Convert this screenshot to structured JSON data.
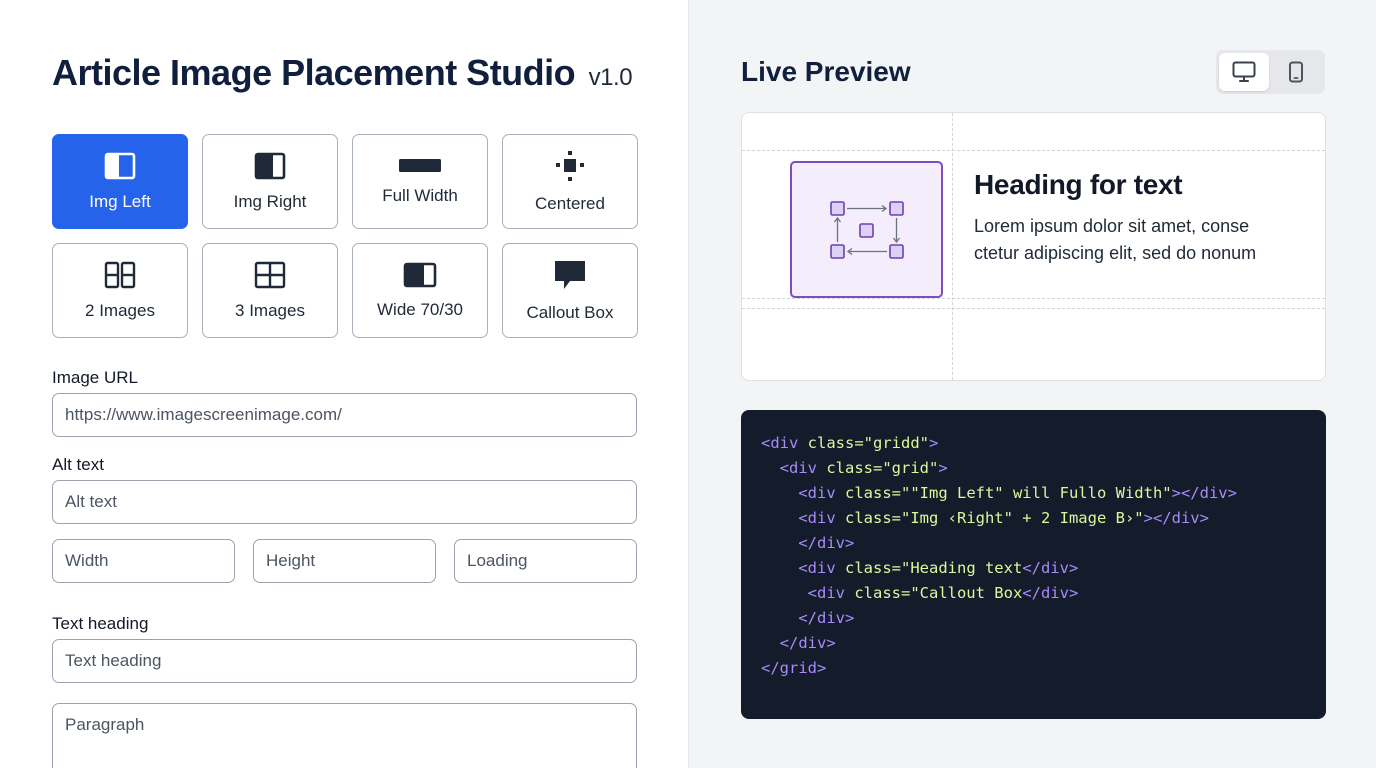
{
  "app": {
    "title": "Article Image Placement Studio",
    "version": "v1.0"
  },
  "layouts": [
    {
      "label": "Img Left",
      "icon": "img-left-icon",
      "active": true
    },
    {
      "label": "Img Right",
      "icon": "img-right-icon",
      "active": false
    },
    {
      "label": "Full Width",
      "icon": "full-width-icon",
      "active": false
    },
    {
      "label": "Centered",
      "icon": "centered-icon",
      "active": false
    },
    {
      "label": "2 Images",
      "icon": "two-images-icon",
      "active": false
    },
    {
      "label": "3 Images",
      "icon": "three-images-icon",
      "active": false
    },
    {
      "label": "Wide 70/30",
      "icon": "wide-split-icon",
      "active": false
    },
    {
      "label": "Callout Box",
      "icon": "callout-icon",
      "active": false
    }
  ],
  "form": {
    "image_url": {
      "label": "Image URL",
      "value": "https://www.imagescreenimage.com/"
    },
    "alt_text": {
      "label": "Alt text",
      "placeholder": "Alt text"
    },
    "width": {
      "placeholder": "Width"
    },
    "height": {
      "placeholder": "Height"
    },
    "loading": {
      "placeholder": "Loading"
    },
    "text_heading": {
      "label": "Text heading",
      "placeholder": "Text heading"
    },
    "paragraph": {
      "placeholder": "Paragraph"
    }
  },
  "preview": {
    "title": "Live Preview",
    "devices": [
      {
        "name": "desktop-icon",
        "active": true
      },
      {
        "name": "mobile-icon",
        "active": false
      }
    ],
    "heading": "Heading for text",
    "paragraph_lines": [
      "Lorem ipsum dolor sit amet, conse",
      "ctetur adipiscing elit, sed do nonum"
    ]
  },
  "code_lines": [
    [
      [
        "t",
        "<div "
      ],
      [
        "x",
        "class=\"gridd\""
      ],
      [
        "t",
        ">"
      ]
    ],
    [
      [
        "t",
        "  <div "
      ],
      [
        "x",
        "class=\"grid\""
      ],
      [
        "t",
        ">"
      ]
    ],
    [
      [
        "t",
        "    <div "
      ],
      [
        "x",
        "class=\"\"Img Left\" will Fullo Width\""
      ],
      [
        "t",
        "></div>"
      ]
    ],
    [
      [
        "t",
        "    <div "
      ],
      [
        "x",
        "class=\"Img ‹Right\" + 2 Image B›\""
      ],
      [
        "t",
        "></div>"
      ]
    ],
    [
      [
        "t",
        "    </div>"
      ]
    ],
    [
      [
        "t",
        "    <div "
      ],
      [
        "x",
        "class=\"Heading text"
      ],
      [
        "t",
        "</div>"
      ]
    ],
    [
      [
        "t",
        "     <div "
      ],
      [
        "x",
        "class=\"Callout Box"
      ],
      [
        "t",
        "</div>"
      ]
    ],
    [
      [
        "t",
        "    </div>"
      ]
    ],
    [
      [
        "t",
        "  </div>"
      ]
    ],
    [
      [
        "t",
        "</grid>"
      ]
    ]
  ]
}
